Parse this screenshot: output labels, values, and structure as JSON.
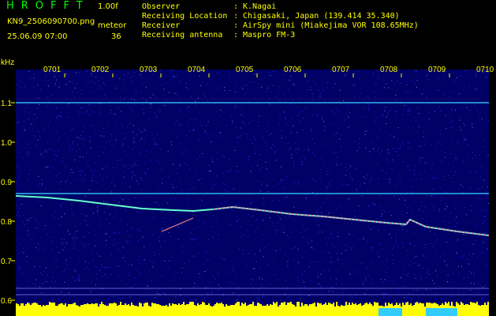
{
  "header": {
    "app_title": "HROFFT",
    "version": "1.00f",
    "filename": "KN9_2506090700.png",
    "datetime": "25.06.09 07:00",
    "meteor_label": "meteor",
    "meteor_count": "36"
  },
  "info": {
    "observer_label": "Observer",
    "observer_value": "K.Nagai",
    "location_label": "Receiving Location",
    "location_value": "Chigasaki, Japan (139.414 35.340)",
    "receiver_label": "Receiver",
    "receiver_value": "AirSpy mini (Miakejima VOR 108.65MHz)",
    "antenna_label": "Receiving antenna",
    "antenna_value": "Maspro FM-3",
    "separator": ":"
  },
  "axes": {
    "y_unit": "kHz",
    "y_ticks": [
      "1.1",
      "1.0",
      "0.9",
      "0.8",
      "0.7",
      "0.6"
    ],
    "x_ticks": [
      "0701",
      "0702",
      "0703",
      "0704",
      "0705",
      "0706",
      "0707",
      "0708",
      "0709",
      "0710"
    ]
  },
  "colors": {
    "background": "#000000",
    "noise_dark": "#000066",
    "noise_light": "#2a2aff",
    "header_text": "#ffff00",
    "title_text": "#00ff00",
    "carrier_line": "#33ccff",
    "bottom_band": "#ffff00"
  }
}
